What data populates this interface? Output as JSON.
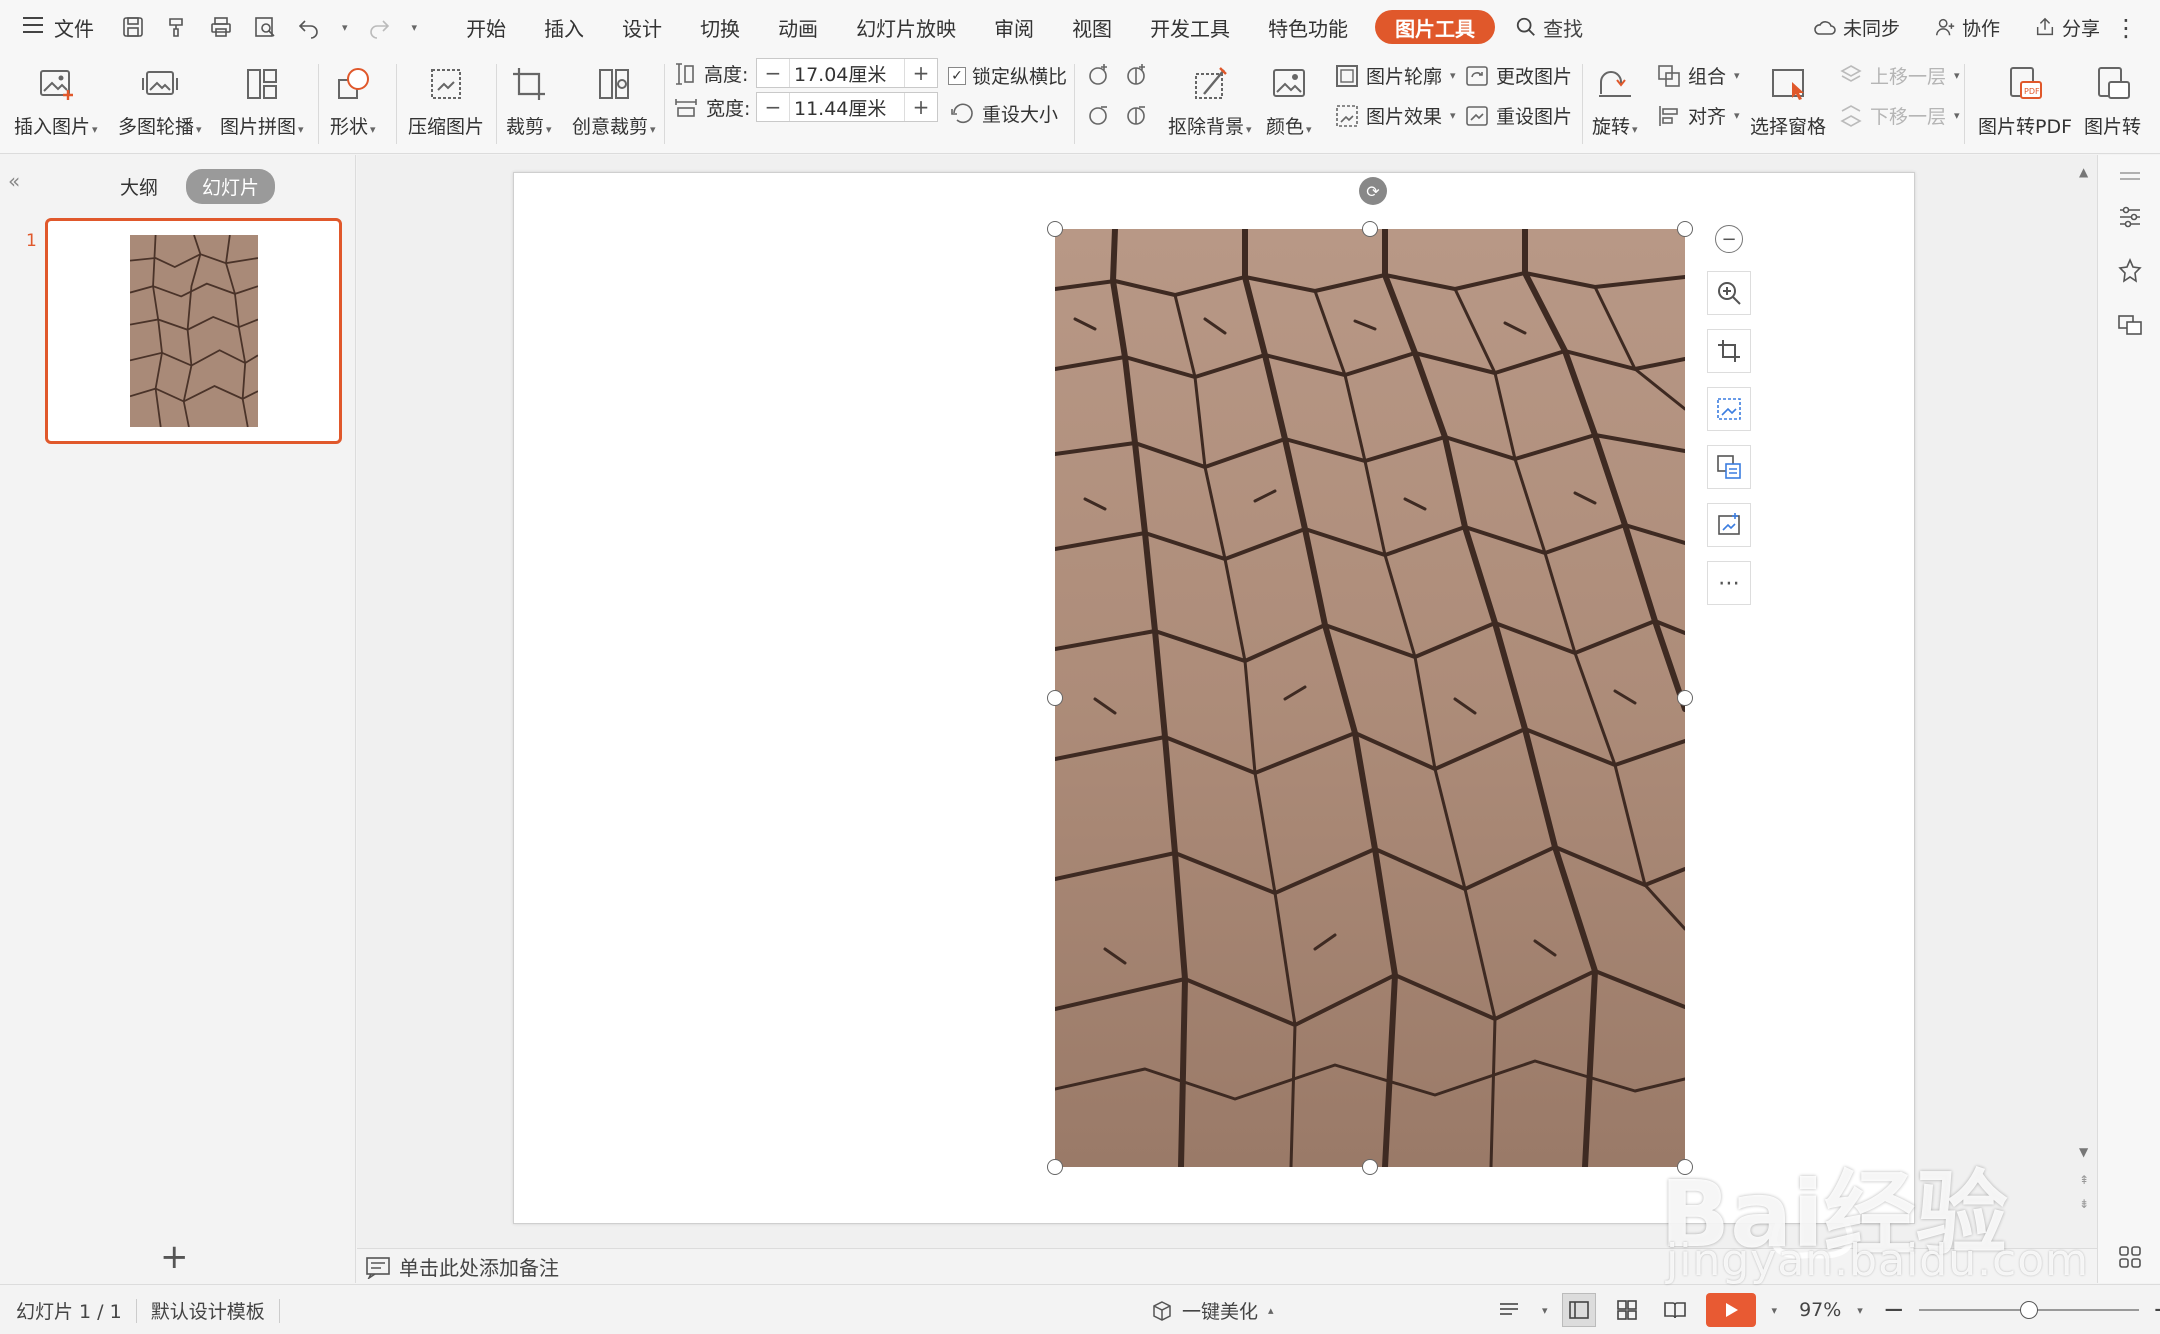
{
  "menubar": {
    "file_label": "文件",
    "tabs": [
      "开始",
      "插入",
      "设计",
      "切换",
      "动画",
      "幻灯片放映",
      "审阅",
      "视图",
      "开发工具",
      "特色功能"
    ],
    "active_tab": "图片工具",
    "search_label": "查找",
    "right": {
      "sync": "未同步",
      "collab": "协作",
      "share": "分享"
    }
  },
  "ribbon": {
    "insert_picture": "插入图片",
    "multi_carousel": "多图轮播",
    "picture_collage": "图片拼图",
    "shape": "形状",
    "compress": "压缩图片",
    "crop": "裁剪",
    "creative_crop": "创意裁剪",
    "height_label": "高度:",
    "height_value": "17.04厘米",
    "width_label": "宽度:",
    "width_value": "11.44厘米",
    "lock_ratio": "锁定纵横比",
    "reset_size": "重设大小",
    "remove_bg": "抠除背景",
    "color": "颜色",
    "outline": "图片轮廓",
    "effects": "图片效果",
    "change_picture": "更改图片",
    "reset_picture": "重设图片",
    "rotate": "旋转",
    "group": "组合",
    "align": "对齐",
    "selection_pane": "选择窗格",
    "bring_forward": "上移一层",
    "send_backward": "下移一层",
    "to_pdf": "图片转PDF",
    "convert": "图片转"
  },
  "leftpanel": {
    "tab_outline": "大纲",
    "tab_slides": "幻灯片",
    "slide_number": "1"
  },
  "notes": {
    "placeholder": "单击此处添加备注"
  },
  "statusbar": {
    "slide_info": "幻灯片 1 / 1",
    "template": "默认设计模板",
    "beautify": "一键美化",
    "zoom": "97%"
  },
  "zoom_level": 0.5,
  "watermark": {
    "brand": "Bai经验",
    "url": "jingyan.baidu.com"
  },
  "colors": {
    "accent": "#e0582b",
    "play": "#e85a33"
  }
}
